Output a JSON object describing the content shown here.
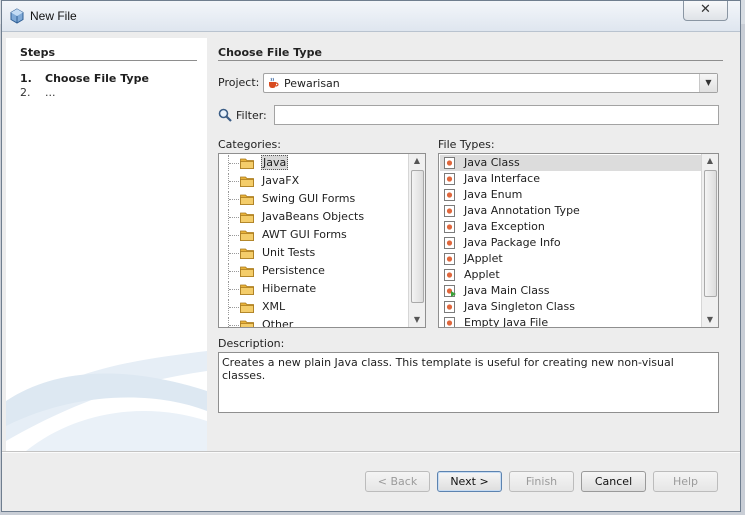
{
  "window": {
    "title": "New File",
    "close_glyph": "✕"
  },
  "steps": {
    "title": "Steps",
    "items": [
      {
        "num": "1.",
        "label": "Choose File Type"
      },
      {
        "num": "2.",
        "label": "..."
      }
    ]
  },
  "main": {
    "title": "Choose File Type",
    "project_label": "Project:",
    "project_value": "Pewarisan",
    "filter_label": "Filter:",
    "filter_value": "",
    "categories_label": "Categories:",
    "categories": [
      "Java",
      "JavaFX",
      "Swing GUI Forms",
      "JavaBeans Objects",
      "AWT GUI Forms",
      "Unit Tests",
      "Persistence",
      "Hibernate",
      "XML",
      "Other"
    ],
    "selected_category": "Java",
    "file_types_label": "File Types:",
    "file_types": [
      "Java Class",
      "Java Interface",
      "Java Enum",
      "Java Annotation Type",
      "Java Exception",
      "Java Package Info",
      "JApplet",
      "Applet",
      "Java Main Class",
      "Java Singleton Class",
      "Empty Java File"
    ],
    "selected_file_type": "Java Class",
    "description_label": "Description:",
    "description": "Creates a new plain Java class. This template is useful for creating new non-visual classes."
  },
  "buttons": {
    "back": "< Back",
    "next": "Next >",
    "finish": "Finish",
    "cancel": "Cancel",
    "help": "Help"
  },
  "colors": {
    "folder": "#e8b23a",
    "selection": "#dcdcdc",
    "accent": "#5c83b0"
  }
}
